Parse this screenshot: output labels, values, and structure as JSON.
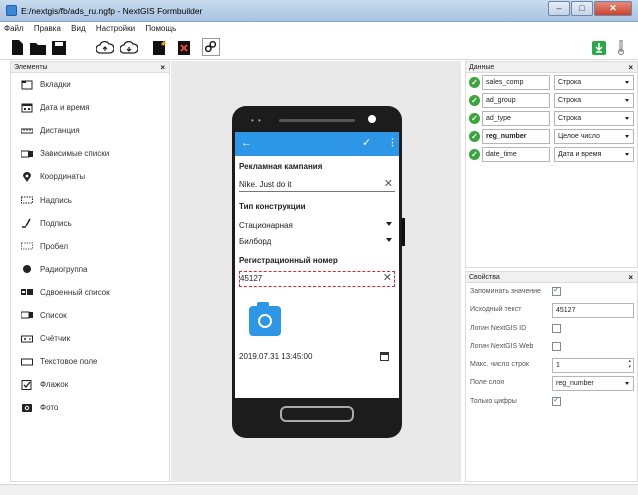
{
  "window": {
    "title": "E:/nextgis/fb/ads_ru.ngfp - NextGIS Formbuilder",
    "minimize": "–",
    "maximize": "□",
    "close": "✕"
  },
  "menu": [
    "Файл",
    "Правка",
    "Вид",
    "Настройки",
    "Помощь"
  ],
  "toolbar": {
    "icons": [
      "new-file-icon",
      "open-folder-icon",
      "save-icon",
      "cloud-upload-icon",
      "cloud-download-icon",
      "add-document-icon",
      "delete-document-icon",
      "link-icon",
      "export-icon",
      "thermometer-icon"
    ]
  },
  "elements_panel": {
    "title": "Элементы",
    "close": "×",
    "items": [
      {
        "label": "Вкладки",
        "icon": "tabs-icon"
      },
      {
        "label": "Дата и время",
        "icon": "calendar-icon"
      },
      {
        "label": "Дистанция",
        "icon": "ruler-icon"
      },
      {
        "label": "Зависимые списки",
        "icon": "dependent-list-icon"
      },
      {
        "label": "Координаты",
        "icon": "location-pin-icon"
      },
      {
        "label": "Надпись",
        "icon": "text-label-icon"
      },
      {
        "label": "Подпись",
        "icon": "signature-icon"
      },
      {
        "label": "Пробел",
        "icon": "space-icon"
      },
      {
        "label": "Радиогруппа",
        "icon": "radio-icon"
      },
      {
        "label": "Сдвоенный список",
        "icon": "double-list-icon"
      },
      {
        "label": "Список",
        "icon": "list-icon"
      },
      {
        "label": "Счётчик",
        "icon": "counter-icon"
      },
      {
        "label": "Текстовое поле",
        "icon": "textfield-icon"
      },
      {
        "label": "Флажок",
        "icon": "checkbox-icon"
      },
      {
        "label": "Фото",
        "icon": "camera-icon"
      }
    ]
  },
  "phone": {
    "status_dots": "• •",
    "appbar": {
      "back": "←",
      "check": "✓",
      "more": "⋮"
    },
    "ad_campaign_label": "Рекламная кампания",
    "ad_campaign_value": "Nike. Just do it",
    "construction_type_label": "Тип конструкции",
    "construction_type_1": "Стационарная",
    "construction_type_2": "Билборд",
    "reg_number_label": "Регистрационный номер",
    "reg_number_value": "45127",
    "clear_glyph": "✕",
    "datetime_value": "2019.07.31 13:45:00"
  },
  "data_panel": {
    "title": "Данные",
    "close": "×",
    "rows": [
      {
        "field": "sales_comp",
        "type": "Строка",
        "bold": false
      },
      {
        "field": "ad_group",
        "type": "Строка",
        "bold": false
      },
      {
        "field": "ad_type",
        "type": "Строка",
        "bold": false
      },
      {
        "field": "reg_number",
        "type": "Целое число",
        "bold": true
      },
      {
        "field": "date_time",
        "type": "Дата и время",
        "bold": false
      }
    ],
    "status_color": "#3aa53a"
  },
  "properties_panel": {
    "title": "Свойства",
    "close": "×",
    "remember_label": "Запоминать значение",
    "remember_checked": true,
    "initial_text_label": "Исходный текст",
    "initial_text_value": "45127",
    "nextgis_id_label": "Логин NextGIS ID",
    "nextgis_id_checked": false,
    "nextgis_web_label": "Логин NextGIS Web",
    "nextgis_web_checked": false,
    "max_lines_label": "Макс. число строк",
    "max_lines_value": "1",
    "layer_field_label": "Поле слоя",
    "layer_field_value": "reg_number",
    "digits_only_label": "Только цифры",
    "digits_only_checked": true
  },
  "colors": {
    "accent": "#2d96e6",
    "selection": "#d12c2c",
    "ok": "#3aa53a"
  }
}
